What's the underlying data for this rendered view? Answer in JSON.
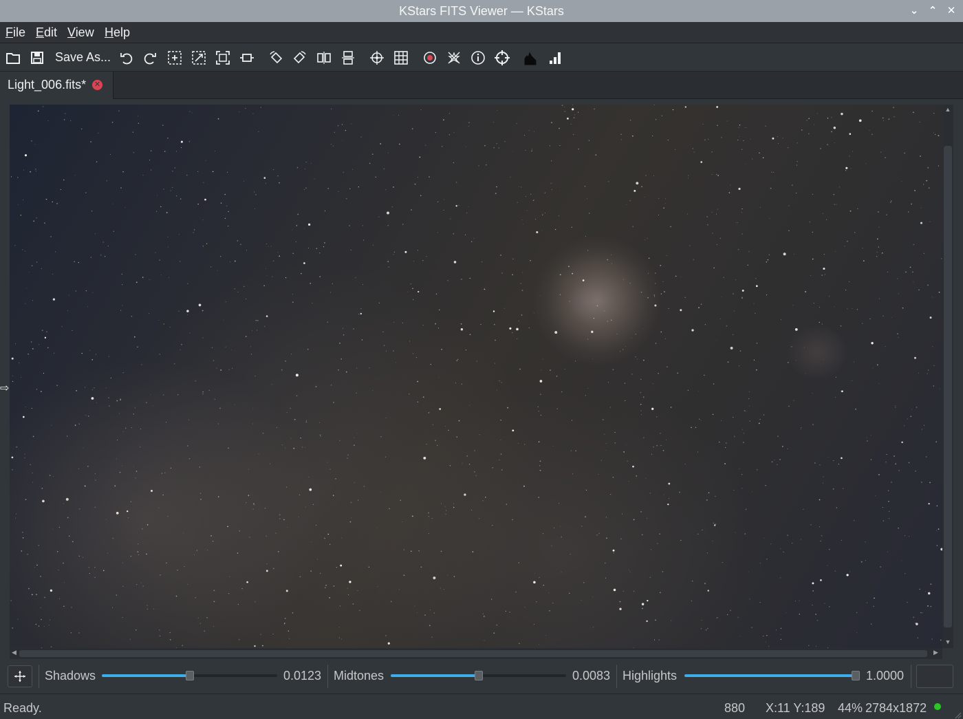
{
  "window": {
    "title": "KStars FITS Viewer — KStars",
    "controls": [
      "minimize",
      "maximize",
      "close"
    ]
  },
  "menubar": {
    "items": [
      {
        "label": "File",
        "mnemonic": "F",
        "rest": "ile"
      },
      {
        "label": "Edit",
        "mnemonic": "E",
        "rest": "dit"
      },
      {
        "label": "View",
        "mnemonic": "V",
        "rest": "iew"
      },
      {
        "label": "Help",
        "mnemonic": "H",
        "rest": "elp"
      }
    ]
  },
  "toolbar": {
    "save_as_label": "Save As...",
    "icons": [
      "open-icon",
      "save-icon",
      "undo-icon",
      "redo-icon",
      "zoom-in-icon",
      "zoom-out-icon",
      "zoom-fit-icon",
      "zoom-width-icon",
      "rotate-cw-icon",
      "rotate-ccw-icon",
      "flip-horizontal-icon",
      "flip-vertical-icon",
      "crosshair-icon",
      "pixel-grid-icon",
      "mark-stars-icon",
      "star-profile-icon",
      "header-info-icon",
      "eq-grid-icon",
      "histogram-icon",
      "statistics-icon"
    ]
  },
  "tabs": [
    {
      "label": "Light_006.fits*",
      "active": true
    }
  ],
  "stretch": {
    "shadows": {
      "label": "Shadows",
      "value": "0.0123",
      "position": 0.5
    },
    "midtones": {
      "label": "Midtones",
      "value": "0.0083",
      "position": 0.5
    },
    "highlights": {
      "label": "Highlights",
      "value": "1.0000",
      "position": 1.0
    }
  },
  "status": {
    "message": "Ready.",
    "pixel_value": "880",
    "coordinates": "X:11 Y:189",
    "zoom": "44%",
    "resolution": "2784x1872",
    "indicator_color": "#27c920"
  },
  "colors": {
    "accent": "#3daee9",
    "background": "#31363b",
    "close_badge": "#da4453"
  }
}
